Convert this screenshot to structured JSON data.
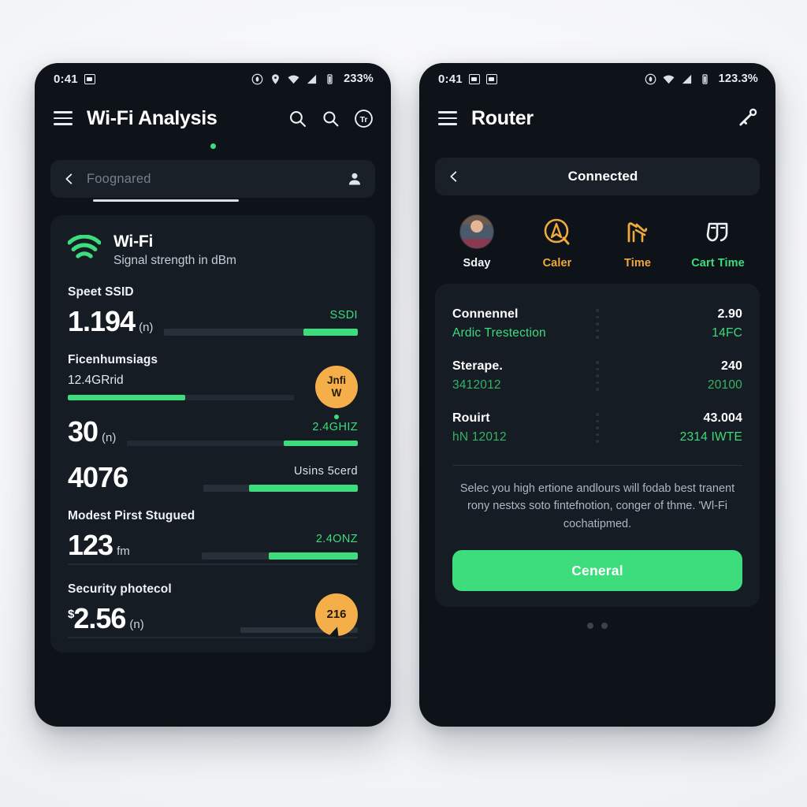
{
  "left_phone": {
    "status_bar": {
      "time": "0:41",
      "battery_percent": "233%",
      "left_icons": [
        "message-icon"
      ],
      "right_icons": [
        "eye-icon",
        "location-icon",
        "wifi-icon",
        "signal-icon",
        "battery-icon"
      ]
    },
    "app_bar": {
      "menu_icon": "hamburger-menu-icon",
      "title": "Wi-Fi Analysis",
      "actions": [
        "search-icon",
        "search-icon",
        "circled-info-icon"
      ]
    },
    "search": {
      "back_icon": "chevron-left-icon",
      "placeholder": "Foognared",
      "profile_icon": "person-icon"
    },
    "card": {
      "icon": "wifi-signal-icon",
      "title": "Wi-Fi",
      "subtitle": "Signal strength in dBm",
      "metrics": [
        {
          "label": "Speet SSID",
          "value": "1.194",
          "unit": "(n)",
          "currency": "",
          "caption": "SSDI",
          "caption_color": "#3ddc7c",
          "bar_fill_percent": 28,
          "bar_align": "right",
          "bar_width_percent": 100
        },
        {
          "label": "Ficenhumsiags",
          "value": "",
          "unit": "",
          "currency": "",
          "sub_value": "12.4GRrid",
          "caption": "",
          "caption_color": "#3ddc7c",
          "bar_fill_percent": 45,
          "bar_align": "left",
          "bar_width_percent": 100,
          "badge": {
            "name": "info-badge",
            "line1": "Jnfi",
            "line2": "W"
          }
        },
        {
          "label": "",
          "value": "30",
          "unit": "(n)",
          "currency": "",
          "caption": "2.4GHIZ",
          "caption_color": "#3ddc7c",
          "bar_fill_percent": 32,
          "bar_align": "right",
          "bar_width_percent": 100
        },
        {
          "label": "",
          "value": "4076",
          "unit": "",
          "currency": "",
          "caption": "Usins 5cerd",
          "caption_color": "#dbe1ea",
          "bar_fill_percent": 70,
          "bar_align": "right",
          "bar_width_percent": 100
        },
        {
          "label": "Modest Pirst Stugued",
          "value": "123",
          "unit": "fm",
          "currency": "",
          "caption": "2.4ONZ",
          "caption_color": "#3ddc7c",
          "bar_fill_percent": 57,
          "bar_align": "right",
          "bar_width_percent": 100
        },
        {
          "label": "Security photecol",
          "value": "2.56",
          "unit": "(n)",
          "currency": "$",
          "caption": "",
          "caption_color": "#dbe1ea",
          "bar_fill_percent": 0,
          "bar_align": "right",
          "bar_width_percent": 100,
          "badge": {
            "name": "count-badge",
            "line1": "216",
            "line2": ""
          }
        }
      ]
    }
  },
  "right_phone": {
    "status_bar": {
      "time": "0:41",
      "battery_percent": "123.3%",
      "left_icons": [
        "message-icon",
        "message-icon"
      ],
      "right_icons": [
        "eye-icon",
        "wifi-icon",
        "signal-icon",
        "battery-icon"
      ]
    },
    "app_bar": {
      "menu_icon": "hamburger-menu-icon",
      "title": "Router",
      "actions": [
        "key-icon"
      ]
    },
    "status_pill": {
      "back_icon": "chevron-left-icon",
      "label": "Connected"
    },
    "quick_actions": [
      {
        "icon": "user-avatar",
        "label": "Sday",
        "color": "#f1f4f8"
      },
      {
        "icon": "compass-icon",
        "label": "Caler",
        "color": "#f0a93c"
      },
      {
        "icon": "router-antenna-icon",
        "label": "Time",
        "color": "#f0a93c"
      },
      {
        "icon": "shield-icon",
        "label": "Cart Time",
        "color": "#3ddc7c"
      }
    ],
    "detail_rows": [
      {
        "title": "Connennel",
        "subtitle": "Ardic Trestection",
        "value": "2.90",
        "value_sub": "14FC"
      },
      {
        "title": "Sterape.",
        "subtitle": "3412012",
        "value": "240",
        "value_sub": "20100"
      },
      {
        "title": "Rouirt",
        "subtitle": "hN 12012",
        "value": "43.004",
        "value_sub": "2314 IWTE"
      }
    ],
    "blurb": "Selec you high ertione andlours will fodab best tranent rony nestxs soto fintefnotion, conger of thme. 'Wl-Fi cochatipmed.",
    "cta_label": "Ceneral",
    "page_dots": 2
  },
  "theme": {
    "accent_green": "#3ddc7c",
    "accent_amber": "#f4ae4a",
    "phone_bg": "#0e1319",
    "card_bg": "#161c24"
  }
}
